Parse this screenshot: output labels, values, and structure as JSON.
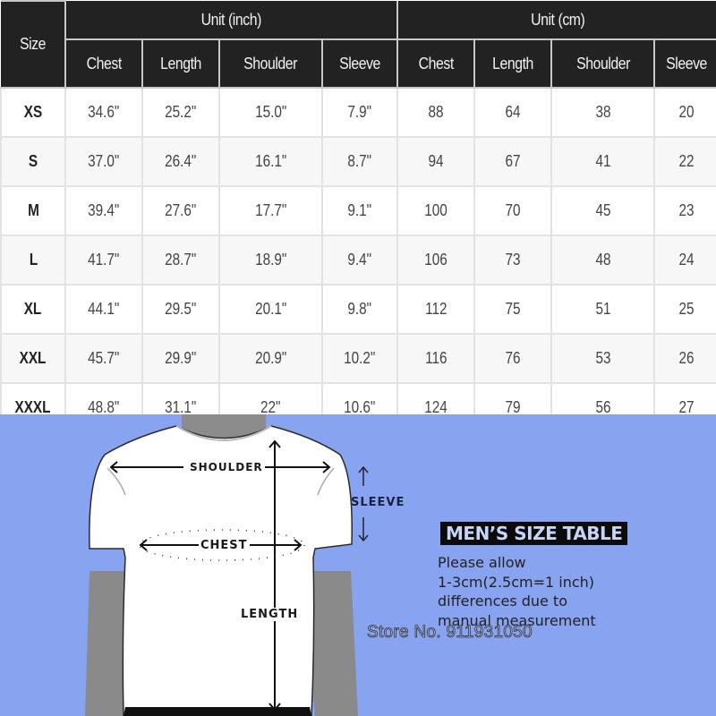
{
  "table": {
    "size_header": "Size",
    "groups": [
      {
        "label": "Unit (inch)"
      },
      {
        "label": "Unit (cm)"
      }
    ],
    "columns_inch": [
      "Chest",
      "Length",
      "Shoulder",
      "Sleeve"
    ],
    "columns_cm": [
      "Chest",
      "Length",
      "Shoulder",
      "Sleeve"
    ],
    "rows": [
      {
        "size": "XS",
        "inch": [
          "34.6\"",
          "25.2\"",
          "15.0\"",
          "7.9\""
        ],
        "cm": [
          "88",
          "64",
          "38",
          "20"
        ]
      },
      {
        "size": "S",
        "inch": [
          "37.0\"",
          "26.4\"",
          "16.1\"",
          "8.7\""
        ],
        "cm": [
          "94",
          "67",
          "41",
          "22"
        ]
      },
      {
        "size": "M",
        "inch": [
          "39.4\"",
          "27.6\"",
          "17.7\"",
          "9.1\""
        ],
        "cm": [
          "100",
          "70",
          "45",
          "23"
        ]
      },
      {
        "size": "L",
        "inch": [
          "41.7\"",
          "28.7\"",
          "18.9\"",
          "9.4\""
        ],
        "cm": [
          "106",
          "73",
          "48",
          "24"
        ]
      },
      {
        "size": "XL",
        "inch": [
          "44.1\"",
          "29.5\"",
          "20.1\"",
          "9.8\""
        ],
        "cm": [
          "112",
          "75",
          "51",
          "25"
        ]
      },
      {
        "size": "XXL",
        "inch": [
          "45.7\"",
          "29.9\"",
          "20.9\"",
          "10.2\""
        ],
        "cm": [
          "116",
          "76",
          "53",
          "26"
        ]
      },
      {
        "size": "XXXL",
        "inch": [
          "48.8\"",
          "31.1\"",
          "22\"",
          "10.6\""
        ],
        "cm": [
          "124",
          "79",
          "56",
          "27"
        ]
      }
    ]
  },
  "figure": {
    "labels": {
      "shoulder": "SHOULDER",
      "sleeve": "SLEEVE",
      "chest": "CHEST",
      "length": "LENGTH"
    },
    "title": "MEN’S  SIZE TABLE",
    "note_lines": [
      "Please allow",
      "1-3cm(2.5cm=1 inch)",
      "differences due to",
      "manual measurement"
    ],
    "store": "Store No. 911931050"
  },
  "colors": {
    "header_bg": "#222222",
    "figure_bg": "#88a3ef",
    "shirt": "#ffffff",
    "body": "#8c8c8c"
  }
}
